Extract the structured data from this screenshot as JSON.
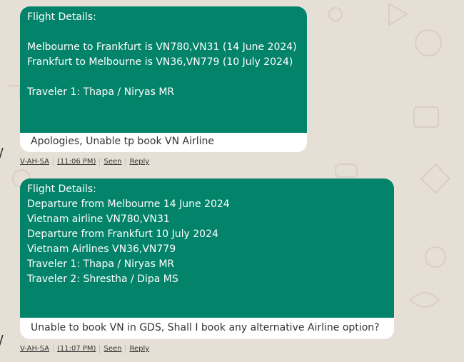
{
  "messages": [
    {
      "lines": [
        "Flight Details:",
        "",
        "Melbourne to Frankfurt is VN780,VN31 (14 June 2024)",
        "Frankfurt to Melbourne is VN36,VN779 (10 July 2024)",
        "",
        "Traveler 1: Thapa / Niryas MR"
      ],
      "caption": "Apologies, Unable tp book VN Airline",
      "meta": {
        "sender": "V-AH-SA",
        "time": "(11:06 PM)",
        "seen": "Seen",
        "reply": "Reply"
      }
    },
    {
      "lines": [
        "Flight Details:",
        "Departure from Melbourne 14 June 2024",
        "Vietnam airline VN780,VN31",
        "Departure from Frankfurt 10 July 2024",
        "Vietnam Airlines VN36,VN779",
        "Traveler 1: Thapa / Niryas MR",
        "Traveler 2: Shrestha / Dipa MS"
      ],
      "caption": "Unable to book VN in GDS, Shall I book any alternative Airline option?",
      "meta": {
        "sender": "V-AH-SA",
        "time": "(11:07 PM)",
        "seen": "Seen",
        "reply": "Reply"
      }
    }
  ],
  "colors": {
    "background": "#e6dfd6",
    "bubble_green": "#03836a",
    "bubble_text": "#ffffff",
    "caption_text": "#333333"
  }
}
